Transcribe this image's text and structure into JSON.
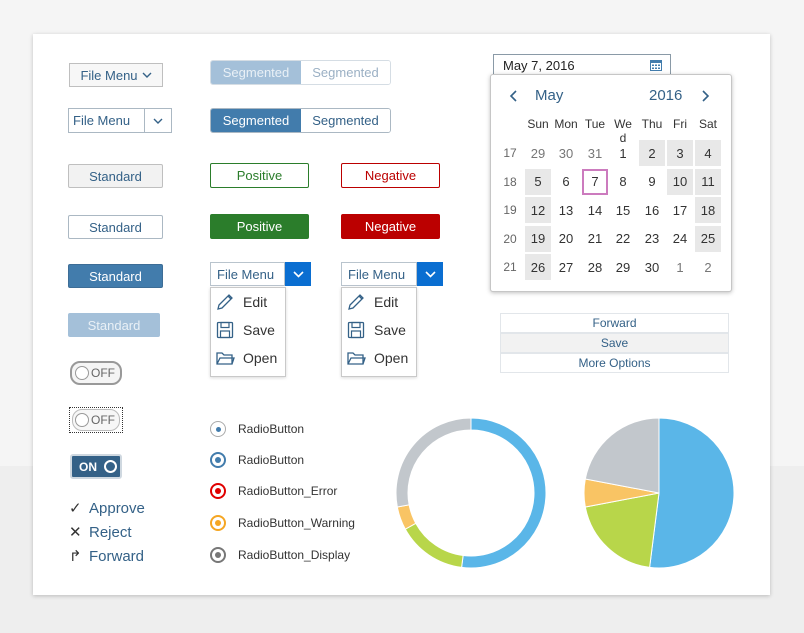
{
  "colors": {
    "blue": "#427cac",
    "positive": "#2b7d2b",
    "negative": "#bb0000",
    "warning": "#f5a623",
    "chart_blue": "#5ab6e8",
    "chart_gray": "#c2c7cc",
    "chart_green": "#b8d64a",
    "chart_orange": "#f9c464"
  },
  "menu_buttons": {
    "file_menu_1": "File Menu",
    "file_menu_2": "File Menu"
  },
  "segmented": {
    "dim": [
      "Segmented",
      "Segmented"
    ],
    "active": [
      "Segmented",
      "Segmented"
    ]
  },
  "buttons": {
    "standard_gray": "Standard",
    "standard_white": "Standard",
    "standard_emph": "Standard",
    "standard_disabled": "Standard",
    "positive_outline": "Positive",
    "negative_outline": "Negative",
    "positive_filled": "Positive",
    "negative_filled": "Negative"
  },
  "split_menus": [
    {
      "label": "File Menu",
      "items": [
        {
          "label": "Edit",
          "icon": "pencil-icon"
        },
        {
          "label": "Save",
          "icon": "floppy-icon"
        },
        {
          "label": "Open",
          "icon": "folder-icon"
        }
      ]
    },
    {
      "label": "File Menu",
      "items": [
        {
          "label": "Edit",
          "icon": "pencil-icon"
        },
        {
          "label": "Save",
          "icon": "floppy-icon"
        },
        {
          "label": "Open",
          "icon": "folder-icon"
        }
      ]
    }
  ],
  "switches": {
    "off1": "OFF",
    "off2": "OFF",
    "on": "ON"
  },
  "actions": [
    {
      "label": "Approve",
      "icon": "checkmark-icon"
    },
    {
      "label": "Reject",
      "icon": "cross-icon"
    },
    {
      "label": "Forward",
      "icon": "forward-arrow-icon"
    }
  ],
  "radios": [
    {
      "label": "RadioButton",
      "state": "normal"
    },
    {
      "label": "RadioButton",
      "state": "selected"
    },
    {
      "label": "RadioButton_Error",
      "state": "error"
    },
    {
      "label": "RadioButton_Warning",
      "state": "warning"
    },
    {
      "label": "RadioButton_Display",
      "state": "display"
    }
  ],
  "datepicker": {
    "value": "May 7, 2016",
    "month": "May",
    "year": "2016"
  },
  "calendar": {
    "weekdays": [
      "Sun",
      "Mon",
      "Tue",
      "We d",
      "Thu",
      "Fri",
      "Sat"
    ],
    "weeks": [
      {
        "num": "17",
        "days": [
          "29",
          "30",
          "31",
          "1",
          "2",
          "3",
          "4"
        ]
      },
      {
        "num": "18",
        "days": [
          "5",
          "6",
          "7",
          "8",
          "9",
          "10",
          "11"
        ]
      },
      {
        "num": "19",
        "days": [
          "12",
          "13",
          "14",
          "15",
          "16",
          "17",
          "18"
        ]
      },
      {
        "num": "20",
        "days": [
          "19",
          "20",
          "21",
          "22",
          "23",
          "24",
          "25"
        ]
      },
      {
        "num": "21",
        "days": [
          "26",
          "27",
          "28",
          "29",
          "30",
          "1",
          "2"
        ]
      }
    ],
    "selected": "7"
  },
  "list_buttons": [
    "Forward",
    "Save",
    "More Options"
  ],
  "donut": [
    {
      "value": 52,
      "color": "#5ab6e8"
    },
    {
      "value": 15,
      "color": "#b8d64a"
    },
    {
      "value": 5,
      "color": "#f9c464"
    },
    {
      "value": 28,
      "color": "#c2c7cc"
    }
  ],
  "pie": [
    {
      "value": 52,
      "color": "#5ab6e8"
    },
    {
      "value": 20,
      "color": "#b8d64a"
    },
    {
      "value": 6,
      "color": "#f9c464"
    },
    {
      "value": 22,
      "color": "#c2c7cc"
    }
  ]
}
